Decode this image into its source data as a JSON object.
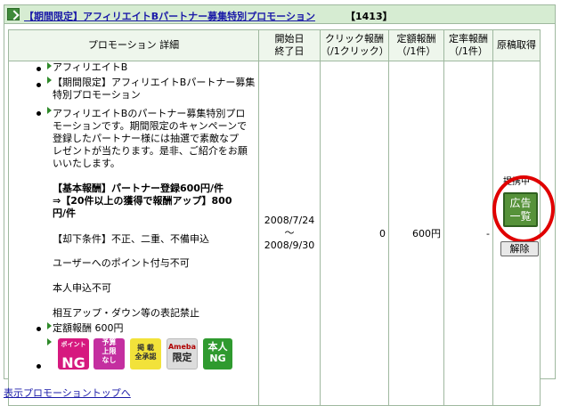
{
  "header": {
    "title": "【期間限定】アフィリエイトBパートナー募集特別プロモーション",
    "id": "【1413】"
  },
  "columns": {
    "detail": "プロモーション 詳細",
    "period_l1": "開始日",
    "period_l2": "終了日",
    "click_l1": "クリック報酬",
    "click_l2": "（/1クリック）",
    "fixed_l1": "定額報酬",
    "fixed_l2": "（/1件）",
    "rate_l1": "定率報酬",
    "rate_l2": "（/1件）",
    "manuscript": "原稿取得"
  },
  "row": {
    "advertiser": "アフィリエイトB",
    "promo_name_l1": "【期間限定】アフィリエイトBパートナー募集",
    "promo_name_l2": "特別プロモーション",
    "desc_lines": [
      "アフィリエイトBのパートナー募集特別プロ",
      "モーションです。期間限定のキャンペーンで",
      "登録したパートナー様には抽選で素敵なプ",
      "レゼントが当たります。是非、ご紹介をお願",
      "いいたします。"
    ],
    "bold_lines": [
      "【基本報酬】パートナー登録600円/件",
      "⇒【20件以上の獲得で報酬アップ】800",
      "円/件"
    ],
    "reject_condition": "【却下条件】不正、二重、不備申込",
    "note_points": "ユーザーへのポイント付与不可",
    "note_self": "本人申込不可",
    "note_updown": "相互アップ・ダウン等の表記禁止",
    "fixed_reward_label": "定額報酬  600円",
    "badges": {
      "point_small": "ポイント",
      "point_big": "NG",
      "budget_l1": "予算",
      "budget_l2": "上限",
      "budget_l3": "なし",
      "listing_l1": "掲 載",
      "listing_l2": "全承認",
      "ameba_l1": "Ameba",
      "ameba_l2": "限定",
      "self_l1": "本人",
      "self_l2": "NG"
    },
    "start_date": "2008/7/24",
    "tilde": "～",
    "end_date": "2008/9/30",
    "click_reward": "0",
    "fixed_reward": "600円",
    "rate_reward": "-",
    "status": "提携中",
    "ad_list_l1": "広告",
    "ad_list_l2": "一覧",
    "cancel": "解除"
  },
  "footer": {
    "back_link": "表示プロモーショントップへ"
  },
  "colors": {
    "header_bg": "#d6ecd2",
    "border": "#9fb89f",
    "link": "#1a1aa8",
    "highlight_ring": "#e00000",
    "ad_button": "#56923a"
  }
}
